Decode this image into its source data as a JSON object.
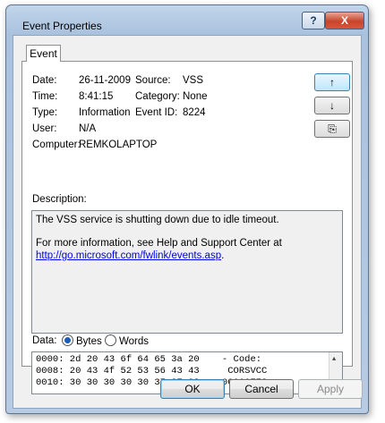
{
  "window": {
    "title": "Event Properties",
    "help_glyph": "?",
    "close_glyph": "X"
  },
  "tab": {
    "label": "Event"
  },
  "fields": {
    "date_label": "Date:",
    "date_value": "26-11-2009",
    "source_label": "Source:",
    "source_value": "VSS",
    "time_label": "Time:",
    "time_value": "8:41:15",
    "category_label": "Category:",
    "category_value": "None",
    "type_label": "Type:",
    "type_value": "Information",
    "event_id_label": "Event ID:",
    "event_id_value": "8224",
    "user_label": "User:",
    "user_value": "N/A",
    "computer_label": "Computer:",
    "computer_value": "REMKOLAPTOP"
  },
  "nav": {
    "up_glyph": "↑",
    "down_glyph": "↓",
    "copy_glyph": "⎘"
  },
  "description": {
    "label": "Description:",
    "line1": "The VSS service is shutting down due to idle timeout.",
    "line2": "For more information, see Help and Support Center at",
    "link": "http://go.microsoft.com/fwlink/events.asp",
    "link_suffix": "."
  },
  "data": {
    "label": "Data:",
    "bytes_label": "Bytes",
    "words_label": "Words",
    "selected": "Bytes",
    "rows": [
      "0000: 2d 20 43 6f 64 65 3a 20    - Code:",
      "0008: 20 43 4f 52 53 56 43 43     CORSVCC",
      "0010: 30 30 30 30 30 37 37 33    00000773"
    ]
  },
  "buttons": {
    "ok": "OK",
    "cancel": "Cancel",
    "apply": "Apply"
  }
}
